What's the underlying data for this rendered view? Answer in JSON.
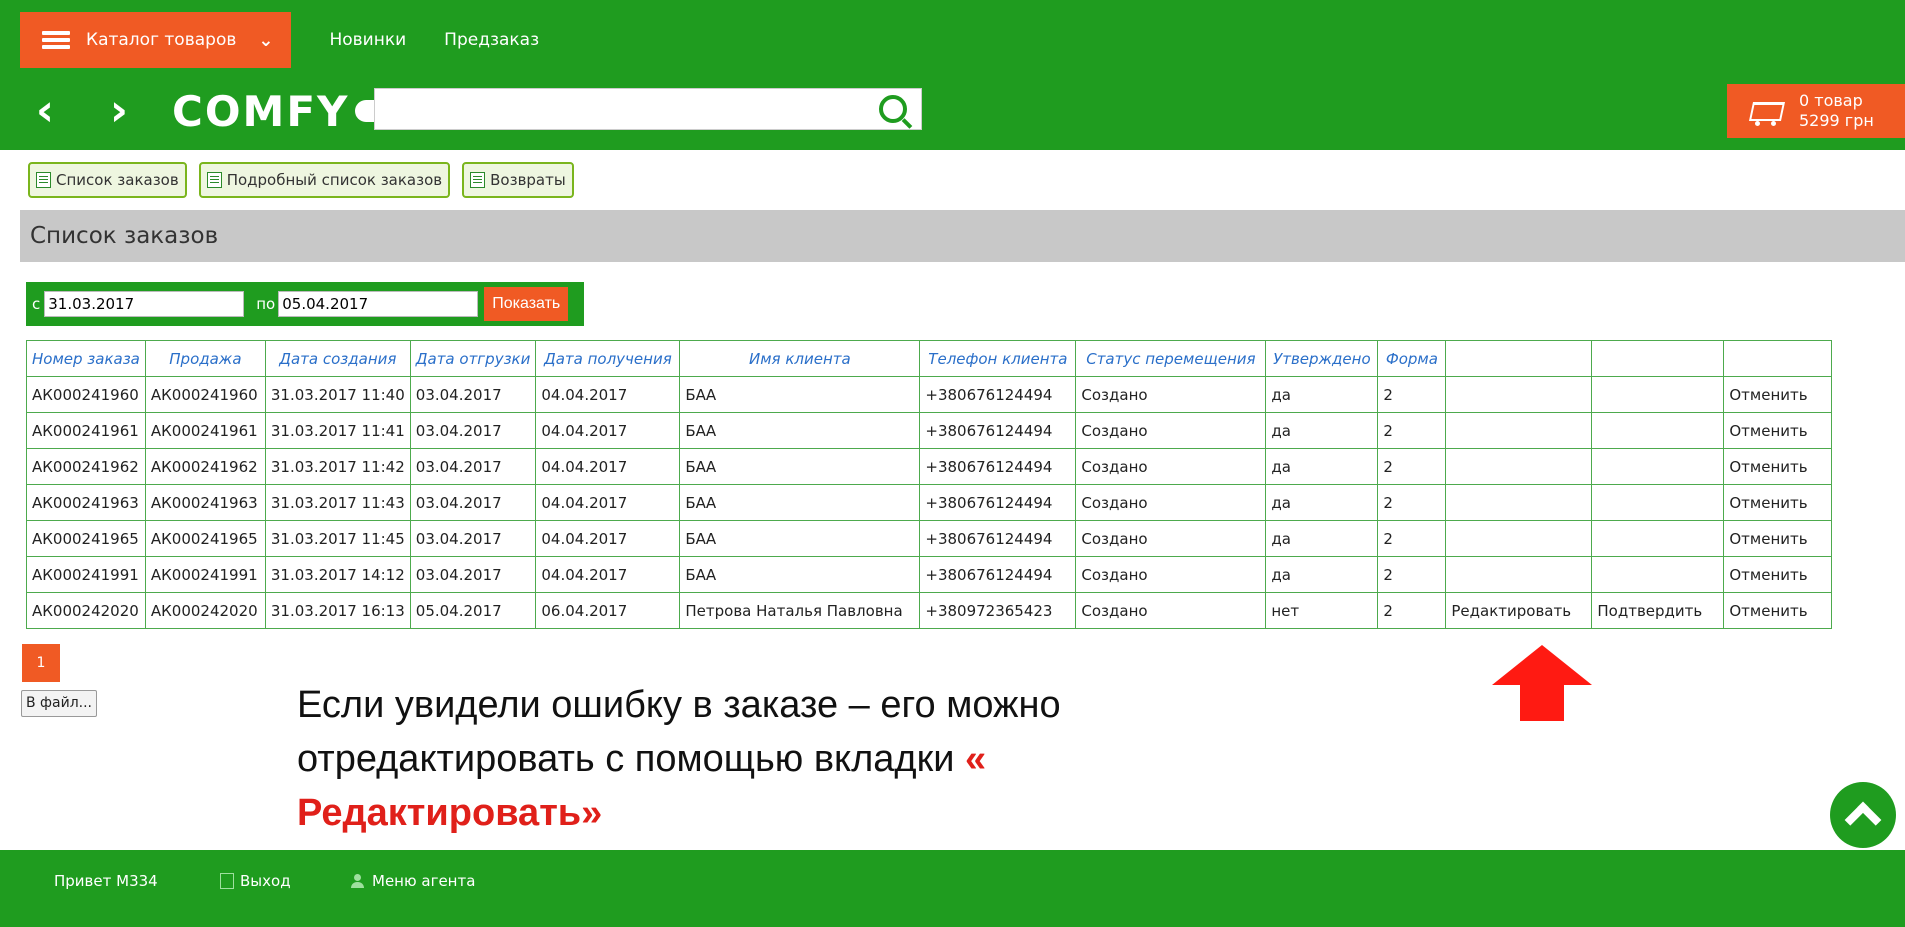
{
  "header": {
    "catalog_label": "Каталог товаров",
    "nav_links": [
      "Новинки",
      "Предзаказ"
    ],
    "logo_text": "COMFY",
    "search_placeholder": "",
    "cart": {
      "count_label": "0 товар",
      "total_label": "5299 грн"
    }
  },
  "subtabs": [
    "Список заказов",
    "Подробный список заказов",
    "Возвраты"
  ],
  "section_title": "Список заказов",
  "filter": {
    "from_label": "с",
    "from_value": "31.03.2017",
    "to_label": "по",
    "to_value": "05.04.2017",
    "show_label": "Показать"
  },
  "table": {
    "headers": [
      "Номер заказа",
      "Продажа",
      "Дата создания",
      "Дата отгрузки",
      "Дата получения",
      "Имя клиента",
      "Телефон клиента",
      "Статус перемещения",
      "Утверждено",
      "Форма",
      "",
      "",
      ""
    ],
    "rows": [
      [
        "АК000241960",
        "АК000241960",
        "31.03.2017 11:40",
        "03.04.2017",
        "04.04.2017",
        "БАА",
        "+380676124494",
        "Создано",
        "да",
        "2",
        "",
        "",
        "Отменить"
      ],
      [
        "АК000241961",
        "АК000241961",
        "31.03.2017 11:41",
        "03.04.2017",
        "04.04.2017",
        "БАА",
        "+380676124494",
        "Создано",
        "да",
        "2",
        "",
        "",
        "Отменить"
      ],
      [
        "АК000241962",
        "АК000241962",
        "31.03.2017 11:42",
        "03.04.2017",
        "04.04.2017",
        "БАА",
        "+380676124494",
        "Создано",
        "да",
        "2",
        "",
        "",
        "Отменить"
      ],
      [
        "АК000241963",
        "АК000241963",
        "31.03.2017 11:43",
        "03.04.2017",
        "04.04.2017",
        "БАА",
        "+380676124494",
        "Создано",
        "да",
        "2",
        "",
        "",
        "Отменить"
      ],
      [
        "АК000241965",
        "АК000241965",
        "31.03.2017 11:45",
        "03.04.2017",
        "04.04.2017",
        "БАА",
        "+380676124494",
        "Создано",
        "да",
        "2",
        "",
        "",
        "Отменить"
      ],
      [
        "АК000241991",
        "АК000241991",
        "31.03.2017 14:12",
        "03.04.2017",
        "04.04.2017",
        "БАА",
        "+380676124494",
        "Создано",
        "да",
        "2",
        "",
        "",
        "Отменить"
      ],
      [
        "АК000242020",
        "АК000242020",
        "31.03.2017 16:13",
        "05.04.2017",
        "06.04.2017",
        "Петрова Наталья Павловна",
        "+380972365423",
        "Создано",
        "нет",
        "2",
        "Редактировать",
        "Подтвердить",
        "Отменить"
      ]
    ]
  },
  "pagination": {
    "current": "1"
  },
  "file_button": "В файл...",
  "annotation": {
    "line1": "Если увидели ошибку в заказе – его можно",
    "line2": "отредактировать с помощью вкладки",
    "quote_open": "«",
    "emphasis": "Редактировать»"
  },
  "footer": {
    "hello": "Привет М334",
    "exit": "Выход",
    "agent_menu": "Меню агента"
  },
  "colors": {
    "brand_green": "#1f9c1f",
    "accent_orange": "#f05a24",
    "action_link": "#f4a640",
    "annotation_red": "#e0201a"
  },
  "icons": [
    "hamburger-icon",
    "chevron-down-icon",
    "back-arrow-icon",
    "forward-arrow-icon",
    "search-icon",
    "cart-icon",
    "list-icon",
    "exit-icon",
    "user-icon",
    "scroll-top-icon",
    "red-up-arrow"
  ]
}
